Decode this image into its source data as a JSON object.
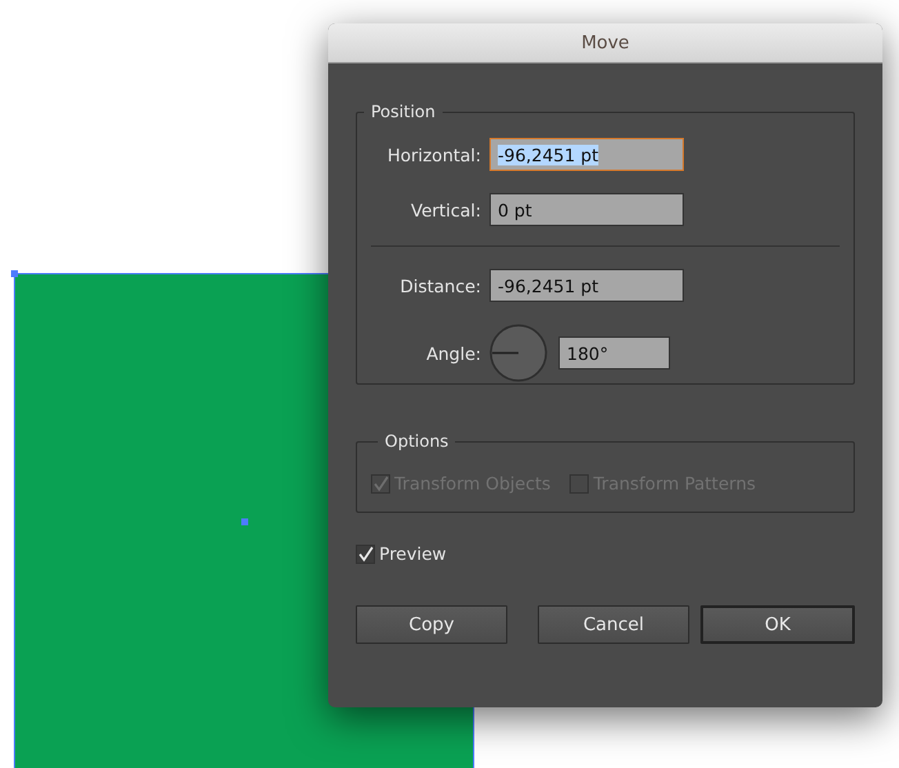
{
  "dialog": {
    "title": "Move"
  },
  "position": {
    "legend": "Position",
    "fields": [
      {
        "label": "Horizontal:",
        "value": "-96,2451 pt",
        "focused": true
      },
      {
        "label": "Vertical:",
        "value": "0 pt",
        "focused": false
      }
    ],
    "distance": {
      "label": "Distance:",
      "value": "-96,2451 pt"
    },
    "angle": {
      "label": "Angle:",
      "value": "180°"
    }
  },
  "options": {
    "legend": "Options",
    "checkboxes": [
      {
        "label": "Transform Objects",
        "checked": true,
        "disabled": true
      },
      {
        "label": "Transform Patterns",
        "checked": false,
        "disabled": true
      }
    ]
  },
  "preview": {
    "label": "Preview",
    "checked": true
  },
  "buttons": [
    {
      "label": "Copy",
      "default": false
    },
    {
      "label": "Cancel",
      "default": false
    },
    {
      "label": "OK",
      "default": true
    }
  ]
}
